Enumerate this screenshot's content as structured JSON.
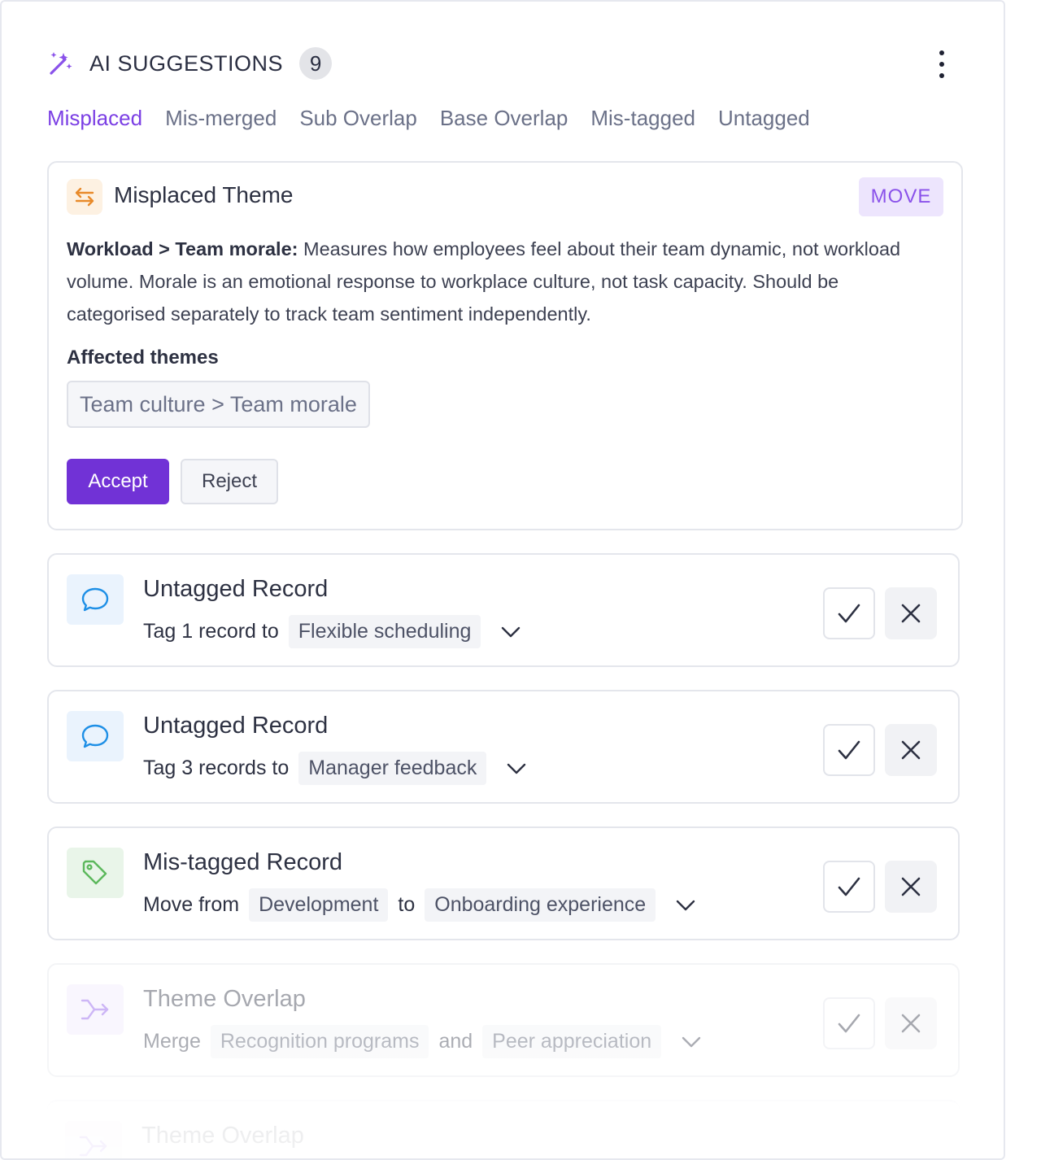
{
  "header": {
    "title": "AI SUGGESTIONS",
    "count": "9",
    "icon": "magic-wand-icon",
    "menu_icon": "more-vertical-icon"
  },
  "tabs": [
    {
      "label": "Misplaced",
      "active": true
    },
    {
      "label": "Mis-merged",
      "active": false
    },
    {
      "label": "Sub Overlap",
      "active": false
    },
    {
      "label": "Base Overlap",
      "active": false
    },
    {
      "label": "Mis-tagged",
      "active": false
    },
    {
      "label": "Untagged",
      "active": false
    }
  ],
  "main_card": {
    "icon": "swap-arrows-icon",
    "title": "Misplaced Theme",
    "badge": "MOVE",
    "description_bold": "Workload > Team morale:",
    "description_text": " Measures how employees feel about their team dynamic, not workload volume. Morale is an emotional response to workplace culture, not task capacity. Should be categorised separately to track team sentiment independently.",
    "affected_label": "Affected themes",
    "affected_theme": "Team culture > Team morale",
    "accept_label": "Accept",
    "reject_label": "Reject"
  },
  "rows": [
    {
      "icon": "chat-bubble-icon",
      "title": "Untagged Record",
      "prefix": "Tag 1 record to",
      "chip1": "Flexible scheduling"
    },
    {
      "icon": "chat-bubble-icon",
      "title": "Untagged Record",
      "prefix": "Tag 3 records to",
      "chip1": "Manager feedback"
    },
    {
      "icon": "tag-icon",
      "title": "Mis-tagged Record",
      "prefix": "Move from",
      "chip1": "Development",
      "joiner": "to",
      "chip2": "Onboarding experience"
    },
    {
      "icon": "merge-arrow-icon",
      "title": "Theme Overlap",
      "prefix": "Merge",
      "chip1": "Recognition programs",
      "joiner": "and",
      "chip2": "Peer appreciation"
    },
    {
      "icon": "merge-arrow-icon",
      "title": "Theme Overlap"
    }
  ],
  "colors": {
    "accent": "#7b3fe4",
    "accept_button": "#7132d6",
    "move_badge_bg": "#ede5fd",
    "chat_icon": "#1e8fe6",
    "tag_icon": "#5cb85c",
    "swap_icon": "#e88a2a"
  }
}
